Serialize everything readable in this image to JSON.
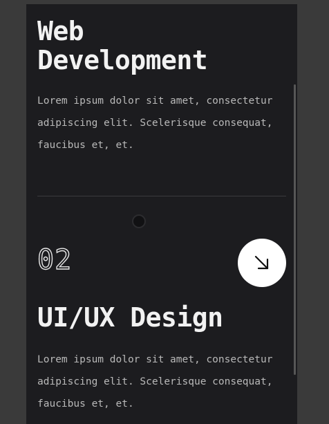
{
  "services": [
    {
      "title": "Web\nDevelopment",
      "description": "Lorem ipsum dolor sit amet, consectetur adipiscing elit. Scelerisque consequat, faucibus et, et."
    },
    {
      "number": "02",
      "title": "UI/UX Design",
      "description": "Lorem ipsum dolor sit amet, consectetur adipiscing elit. Scelerisque consequat, faucibus et, et.",
      "action_icon": "arrow-down-right-icon"
    }
  ],
  "colors": {
    "page_background": "#3a3a3a",
    "panel_background": "#1c1c1f",
    "heading_text": "#f2f2f2",
    "body_text": "#b9b9b9",
    "button_background": "#ffffff",
    "button_icon": "#111111"
  }
}
